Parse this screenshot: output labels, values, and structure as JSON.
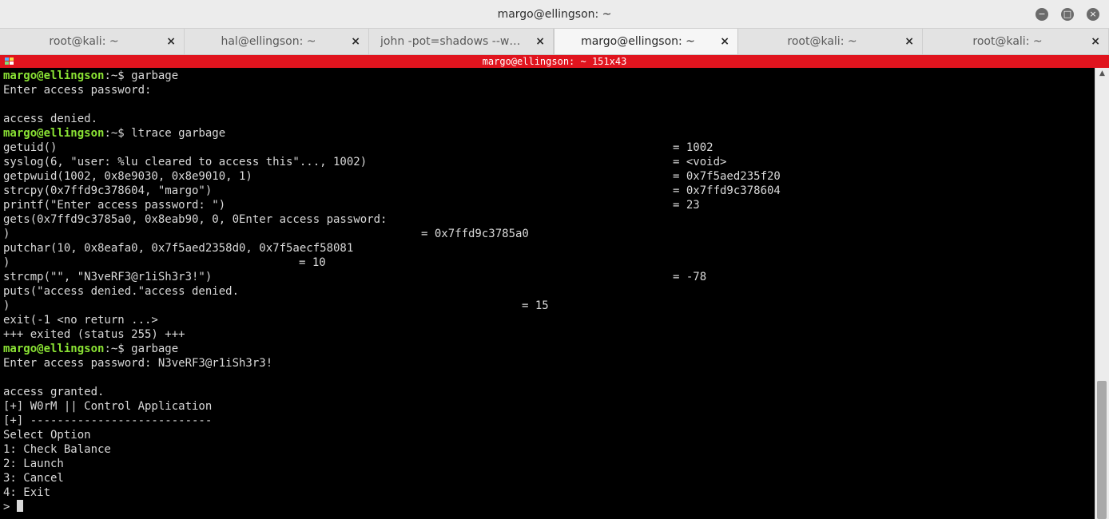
{
  "window": {
    "title": "margo@ellingson: ~",
    "controls": {
      "minimize": "−",
      "maximize": "□",
      "close": "×"
    }
  },
  "tabs": [
    {
      "label": "root@kali: ~",
      "close": "×",
      "active": false
    },
    {
      "label": "hal@ellingson: ~",
      "close": "×",
      "active": false
    },
    {
      "label": "john -pot=shadows --wordlist=/usr/share/wordlists/rockyou.txt",
      "close": "×",
      "active": false
    },
    {
      "label": "margo@ellingson: ~",
      "close": "×",
      "active": true
    },
    {
      "label": "root@kali: ~",
      "close": "×",
      "active": false
    },
    {
      "label": "root@kali: ~",
      "close": "×",
      "active": false
    }
  ],
  "status_bar": {
    "text": "margo@ellingson: ~ 151x43"
  },
  "terminal": {
    "prompt_user": "margo@ellingson",
    "prompt_tail": ":~$ ",
    "lines": [
      {
        "cmd": "garbage"
      },
      {
        "text": "Enter access password:"
      },
      {
        "text": ""
      },
      {
        "text": "access denied."
      },
      {
        "cmd": "ltrace garbage"
      },
      {
        "text": "getuid()",
        "ret": "= 1002"
      },
      {
        "text": "syslog(6, \"user: %lu cleared to access this\"..., 1002)",
        "ret": "= <void>"
      },
      {
        "text": "getpwuid(1002, 0x8e9030, 0x8e9010, 1)",
        "ret": "= 0x7f5aed235f20"
      },
      {
        "text": "strcpy(0x7ffd9c378604, \"margo\")",
        "ret": "= 0x7ffd9c378604"
      },
      {
        "text": "printf(\"Enter access password: \")",
        "ret": "= 23"
      },
      {
        "text": "gets(0x7ffd9c3785a0, 0x8eab90, 0, 0Enter access password:"
      },
      {
        "text": ")",
        "ret": "= 0x7ffd9c3785a0"
      },
      {
        "text": "putchar(10, 0x8eafa0, 0x7f5aed2358d0, 0x7f5aecf58081"
      },
      {
        "text": ")",
        "ret": "= 10"
      },
      {
        "text": "strcmp(\"\", \"N3veRF3@r1iSh3r3!\")",
        "ret": "= -78"
      },
      {
        "text": "puts(\"access denied.\"access denied."
      },
      {
        "text": ")",
        "ret": "= 15"
      },
      {
        "text": "exit(-1 <no return ...>"
      },
      {
        "text": "+++ exited (status 255) +++"
      },
      {
        "cmd": "garbage"
      },
      {
        "text": "Enter access password: N3veRF3@r1iSh3r3!"
      },
      {
        "text": ""
      },
      {
        "text": "access granted."
      },
      {
        "text": "[+] W0rM || Control Application"
      },
      {
        "text": "[+] ---------------------------"
      },
      {
        "text": "Select Option"
      },
      {
        "text": "1: Check Balance"
      },
      {
        "text": "2: Launch"
      },
      {
        "text": "3: Cancel"
      },
      {
        "text": "4: Exit"
      },
      {
        "text": "> "
      }
    ]
  },
  "scrollbar": {
    "up_arrow": "▲",
    "position_fraction": 0.69
  },
  "colors": {
    "status_bar": "#e0141e",
    "prompt": "#8ae234",
    "terminal_text": "#d9d9d9",
    "terminal_bg": "#000000"
  },
  "icons": {
    "terminal_menu": "menu-grid-icon",
    "tab_close": "close-icon",
    "scroll_up": "chevron-up-icon"
  }
}
